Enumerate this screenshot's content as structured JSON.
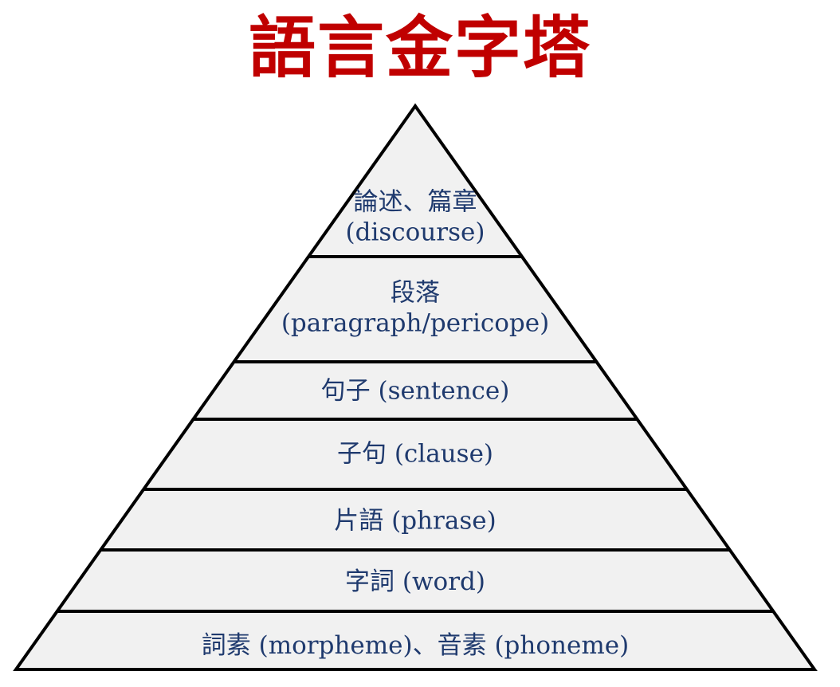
{
  "title": "語言金字塔",
  "colors": {
    "title": "#c00000",
    "band_fill": "#f1f1f1",
    "outline": "#000000",
    "label_text": "#1f3a6e"
  },
  "levels": [
    {
      "lines": [
        "論述、篇章",
        "(discourse)"
      ]
    },
    {
      "lines": [
        "段落",
        "(paragraph/pericope)"
      ]
    },
    {
      "lines": [
        "句子 (sentence)"
      ]
    },
    {
      "lines": [
        "子句 (clause)"
      ]
    },
    {
      "lines": [
        "片語 (phrase)"
      ]
    },
    {
      "lines": [
        "字詞 (word)"
      ]
    },
    {
      "lines": [
        "詞素 (morpheme)、音素 (phoneme)"
      ]
    }
  ]
}
